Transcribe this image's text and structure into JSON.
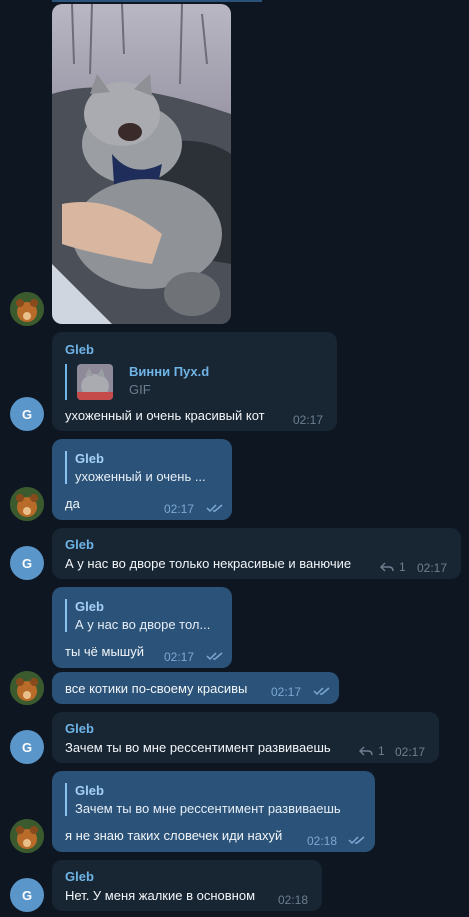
{
  "messages": {
    "m1": {
      "sender": "Gleb",
      "fwd_title": "Винни Пух.d",
      "fwd_subtitle": "GIF",
      "text": "ухоженный и очень красивый кот",
      "time": "02:17"
    },
    "m2": {
      "reply_name": "Gleb",
      "reply_text": "ухоженный и очень ...",
      "text": "да",
      "time": "02:17"
    },
    "m3": {
      "sender": "Gleb",
      "text": "А у нас во дворе только некрасивые и ванючие",
      "reply_count": "1",
      "time": "02:17"
    },
    "m4": {
      "reply_name": "Gleb",
      "reply_text": "А у нас во дворе тол...",
      "text": "ты чё мышуй",
      "time": "02:17"
    },
    "m5": {
      "text": "все котики по-своему красивы",
      "time": "02:17"
    },
    "m6": {
      "sender": "Gleb",
      "text": "Зачем ты во мне рессентимент развиваешь",
      "reply_count": "1",
      "time": "02:17"
    },
    "m7": {
      "reply_name": "Gleb",
      "reply_text": "Зачем ты во мне рессентимент развиваешь",
      "text": "я не знаю таких словечек иди нахуй",
      "time": "02:18"
    },
    "m8": {
      "sender": "Gleb",
      "text": "Нет. У меня жалкие в основном",
      "time": "02:18"
    }
  },
  "avatars": {
    "gleb_letter": "G"
  },
  "colors": {
    "background": "#0e1621",
    "incoming": "#182533",
    "outgoing": "#2b5278",
    "accent": "#6fb4e6"
  }
}
